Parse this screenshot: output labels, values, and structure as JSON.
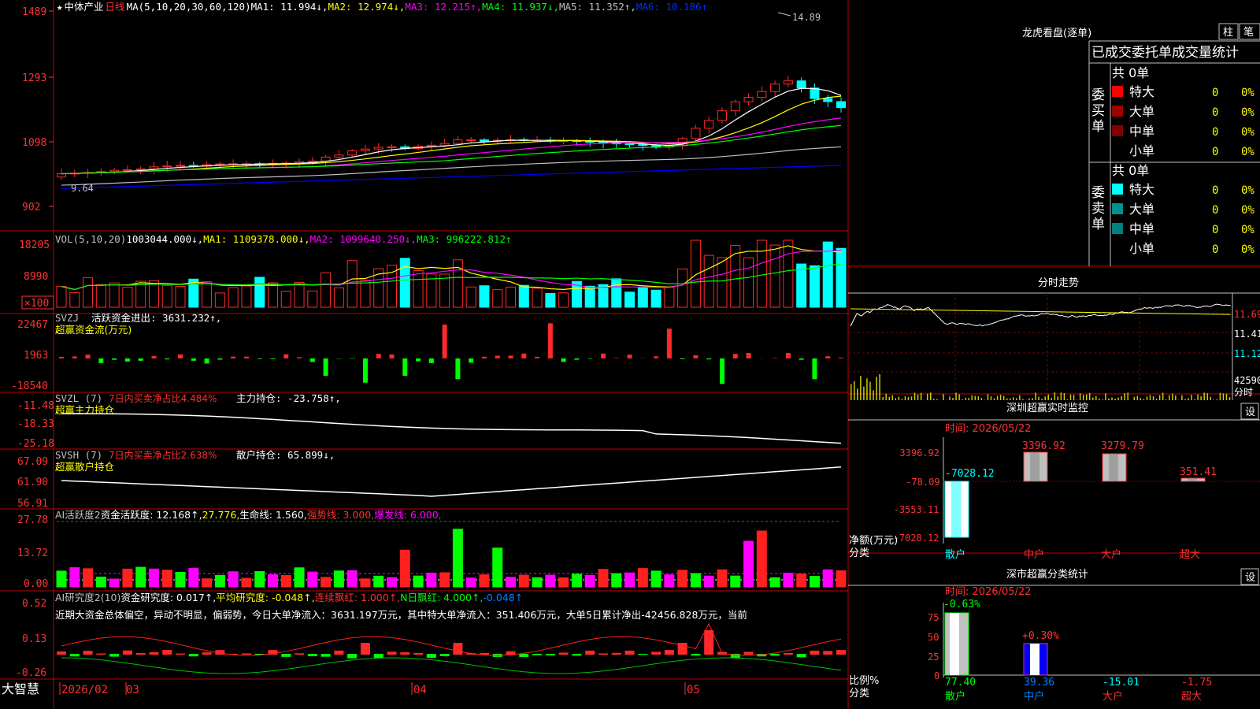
{
  "colors": {
    "up": "#ff2a2a",
    "down": "#00ffff",
    "ma1": "#ffffff",
    "ma2": "#ffff00",
    "ma3": "#ff00ff",
    "ma4": "#00ff00",
    "ma5": "#c0c0c0",
    "ma6": "#0000ff",
    "grid": "#800000",
    "axis": "#ff3232"
  },
  "header": {
    "star": "★",
    "stock_name": "中体产业",
    "period": "日线",
    "ma_params": "MA(5,10,20,30,60,120)",
    "ma1": "MA1: 11.994↓,",
    "ma2": "MA2: 12.974↓,",
    "ma3": "MA3: 12.215↑,",
    "ma4": "MA4: 11.937↓,",
    "ma5": "MA5: 11.352↑,",
    "ma6": "MA6: 10.186↑",
    "high_mark": "14.89",
    "low_mark": "9.64"
  },
  "price_axis": [
    "1489",
    "1293",
    "1098",
    "902"
  ],
  "vol": {
    "label": "VOL(5,10,20)",
    "value": "1003044.000↓,",
    "ma1": "MA1: 1109378.000↓,",
    "ma2": "MA2: 1099640.250↓,",
    "ma3": "MA3: 996222.812↑",
    "axis": [
      "18205",
      "8990",
      "×100"
    ]
  },
  "svzj": {
    "label": "SVZJ",
    "text": "活跃资金进出: 3631.232↑,",
    "sub": "超赢资金流(万元)",
    "axis": [
      "22467",
      "1963",
      "-18540"
    ]
  },
  "svzl": {
    "label": "SVZL (7)",
    "text1": "7日内买卖净占比4.484%",
    "text2": "主力持仓: -23.758↑,",
    "sub": "超赢主力持仓",
    "axis": [
      "-11.48",
      "-18.33",
      "-25.18"
    ]
  },
  "svsh": {
    "label": "SVSH (7)",
    "text1": "7日内买卖净占比2.638%",
    "text2": "散户持仓: 65.899↓,",
    "sub": "超赢散户持仓",
    "axis": [
      "67.09",
      "61.90",
      "56.91"
    ]
  },
  "ai1": {
    "label": "AI活跃度2",
    "text1": "资金活跃度: 12.168↑,",
    "text2": "27.776,",
    "text3": "生命线: 1.560,",
    "text4": "强势线: 3.000,",
    "text5": "爆发线: 6.000,",
    "axis": [
      "27.78",
      "13.72",
      "0.00"
    ]
  },
  "ai2": {
    "label": "AI研究度2(10)",
    "text1": "资金研究度: 0.017↑,",
    "text2": "平均研究度: -0.048↑,",
    "text3": "连续飘红: 1.000↑,",
    "text4": "N日飘红: 4.000↑,",
    "text5": "-0.048↑",
    "desc": "近期大资金总体偏空，异动不明显，偏弱势，今日大单净流入：3631.197万元，其中特大单净流入：351.406万元，大单5日累计净出-42456.828万元，当前",
    "axis": [
      "0.52",
      "0.13",
      "-0.26"
    ]
  },
  "bottom": {
    "brand": "大智慧",
    "d1": "2026/02",
    "d2": "03",
    "d3": "04",
    "d4": "05"
  },
  "lhb": {
    "title": "龙虎看盘(逐单)",
    "btn1": "柱",
    "btn2": "笔",
    "head": "已成交委托单成交量统计",
    "buy_total": "共 0单",
    "sell_total": "共 0单",
    "buy_label": "委买单",
    "sell_label": "委卖单",
    "buy": [
      {
        "name": "特大",
        "n": "0",
        "p": "0%",
        "c": "#ff0000"
      },
      {
        "name": "大单",
        "n": "0",
        "p": "0%",
        "c": "#a00000"
      },
      {
        "name": "中单",
        "n": "0",
        "p": "0%",
        "c": "#800000"
      },
      {
        "name": "小单",
        "n": "0",
        "p": "0%",
        "c": "#000000"
      }
    ],
    "sell": [
      {
        "name": "特大",
        "n": "0",
        "p": "0%",
        "c": "#00ffff"
      },
      {
        "name": "大单",
        "n": "0",
        "p": "0%",
        "c": "#009090"
      },
      {
        "name": "中单",
        "n": "0",
        "p": "0%",
        "c": "#008080"
      },
      {
        "name": "小单",
        "n": "0",
        "p": "0%",
        "c": "#000000"
      }
    ]
  },
  "fs": {
    "title": "分时走势",
    "axis": [
      "11.69",
      "11.41",
      "11.12",
      "42590",
      "分时"
    ]
  },
  "sz1": {
    "title": "深圳超赢实时监控",
    "btn": "设",
    "time": "时间: 2026/05/22",
    "axis": [
      "3396.92",
      "-78.09",
      "-3553.11",
      "-7028.12"
    ],
    "ylabel1": "净额(万元)",
    "ylabel2": "分类",
    "vals": [
      "-7028.12",
      "3396.92",
      "3279.79",
      "351.41"
    ],
    "cats": [
      "散户",
      "中户",
      "大户",
      "超大"
    ]
  },
  "sz2": {
    "title": "深市超赢分类统计",
    "btn": "设",
    "time": "时间: 2026/05/22",
    "axis": [
      "75",
      "50",
      "25",
      "0"
    ],
    "top1": "-0.63%",
    "top2": "+0.30%",
    "ylabel1": "比例%",
    "ylabel2": "分类",
    "vals": [
      "77.40",
      "39.36",
      "-15.01",
      "-1.75"
    ],
    "cats": [
      "散户",
      "中户",
      "大户",
      "超大"
    ]
  }
}
